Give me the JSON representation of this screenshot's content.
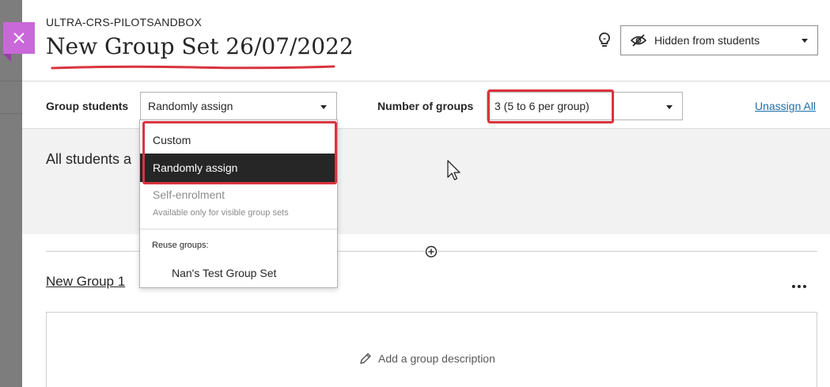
{
  "header": {
    "course_id": "ULTRA-CRS-PILOTSANDBOX",
    "title": "New Group Set 26/07/2022",
    "visibility_label": "Hidden from students"
  },
  "toolbar": {
    "group_students_label": "Group students",
    "group_students_value": "Randomly assign",
    "number_of_groups_label": "Number of groups",
    "number_of_groups_value": "3 (5 to 6 per group)",
    "unassign_all": "Unassign All"
  },
  "dropdown": {
    "options": [
      {
        "label": "Custom"
      },
      {
        "label": "Randomly assign",
        "selected": true
      },
      {
        "label": "Self-enrolment",
        "disabled": true,
        "note": "Available only for visible group sets"
      }
    ],
    "reuse_label": "Reuse groups:",
    "reuse_items": [
      "Nan's Test Group Set"
    ]
  },
  "main": {
    "all_students_label": "All students a",
    "group": {
      "name": "New Group 1",
      "add_description": "Add a group description"
    }
  },
  "colors": {
    "accent_close": "#c968d8",
    "highlight": "#d9343e",
    "selected_bg": "#262626",
    "link": "#1f6fa8"
  },
  "icons": [
    "close-icon",
    "lightbulb-icon",
    "eye-slash-icon",
    "chevron-down-icon",
    "plus-circle-icon",
    "more-horizontal-icon",
    "pencil-icon",
    "mouse-cursor-icon"
  ]
}
